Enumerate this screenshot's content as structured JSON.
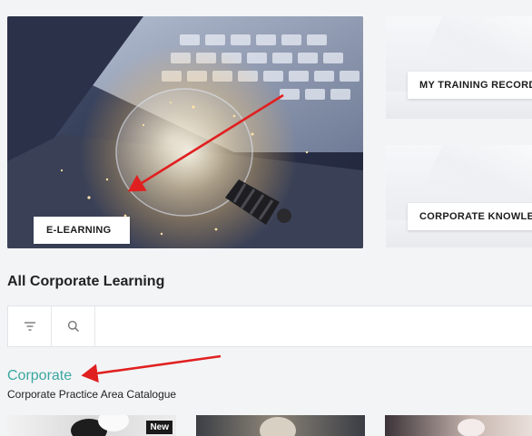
{
  "tiles": {
    "elearning": {
      "label": "E-LEARNING"
    },
    "training_record": {
      "label": "MY TRAINING RECORD"
    },
    "corporate_knowledge": {
      "label": "CORPORATE KNOWLEDGE"
    }
  },
  "section": {
    "title": "All Corporate Learning"
  },
  "toolbar": {
    "filter_icon": "filter-icon",
    "search_icon": "search-icon",
    "search_placeholder": ""
  },
  "catalogue": {
    "title": "Corporate",
    "subtitle": "Corporate Practice Area Catalogue",
    "accent_color": "#3ba7a0"
  },
  "courses": [
    {
      "badge": "New"
    },
    {
      "badge": ""
    },
    {
      "badge": ""
    }
  ],
  "annotations": {
    "arrow_color": "#e02020"
  }
}
